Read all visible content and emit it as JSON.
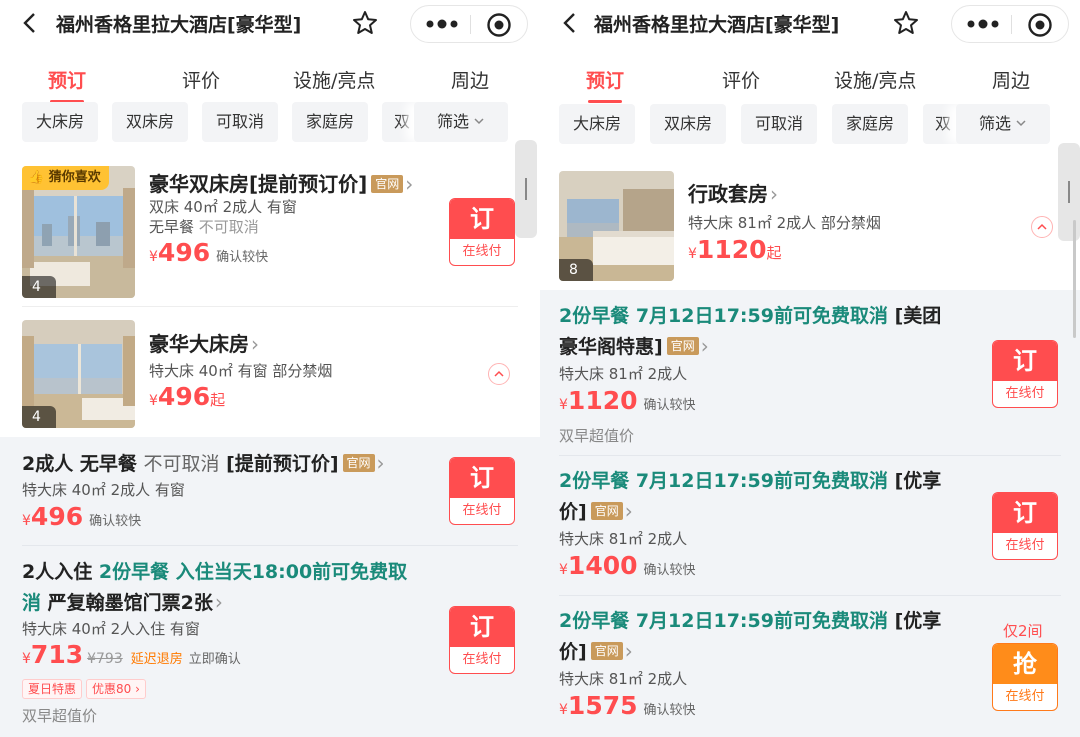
{
  "colors": {
    "accent": "#ff4d4f",
    "teal": "#1a8a7a",
    "official": "#c99a5b",
    "orange": "#ff8c1a",
    "sheet": "#f2f4f7"
  },
  "screen1": {
    "title": "福州香格里拉大酒店[豪华型]",
    "tabs": [
      "预订",
      "评价",
      "设施/亮点",
      "周边"
    ],
    "chips": [
      "大床房",
      "双床房",
      "可取消",
      "家庭房",
      "双"
    ],
    "filter": "筛选",
    "room1": {
      "badge": "猜你喜欢",
      "title": "豪华双床房[提前预订价]",
      "official": "官网",
      "line1": "双床 40㎡ 2成人 有窗",
      "line2a": "无早餐",
      "line2b": "不可取消",
      "currency": "¥",
      "price": "496",
      "confirm": "确认较快",
      "photo_count": "4",
      "book": "订",
      "pay": "在线付"
    },
    "room2": {
      "title": "豪华大床房",
      "line1": "特大床 40㎡ 有窗 部分禁烟",
      "currency": "¥",
      "price": "496",
      "qi": "起",
      "photo_count": "4"
    },
    "offer1": {
      "t1": "2成人",
      "t2": "无早餐",
      "t3": "不可取消",
      "t4": "[提前预订价]",
      "official": "官网",
      "line1": "特大床 40㎡ 2成人 有窗",
      "currency": "¥",
      "price": "496",
      "confirm": "确认较快",
      "book": "订",
      "pay": "在线付"
    },
    "offer2": {
      "t1": "2人入住",
      "t2": "2份早餐 入住当天18:00前可免费取消",
      "t3": "严复翰墨馆门票2张",
      "line1": "特大床 40㎡ 2人入住 有窗",
      "currency": "¥",
      "price": "713",
      "orig": "¥793",
      "late": "延迟退房",
      "instant": "立即确认",
      "tag1": "夏日特惠",
      "tag2": "优惠80",
      "note": "双早超值价",
      "book": "订",
      "pay": "在线付"
    }
  },
  "screen2": {
    "title": "福州香格里拉大酒店[豪华型]",
    "tabs": [
      "预订",
      "评价",
      "设施/亮点",
      "周边"
    ],
    "chips": [
      "大床房",
      "双床房",
      "可取消",
      "家庭房",
      "双"
    ],
    "filter": "筛选",
    "room": {
      "title": "行政套房",
      "line1": "特大床 81㎡ 2成人 部分禁烟",
      "currency": "¥",
      "price": "1120",
      "qi": "起",
      "photo_count": "8"
    },
    "offer1": {
      "t1": "2份早餐 7月12日17:59前可免费取消",
      "t2": "[美团豪华阁特惠]",
      "official": "官网",
      "line1": "特大床 81㎡ 2成人",
      "currency": "¥",
      "price": "1120",
      "confirm": "确认较快",
      "note": "双早超值价",
      "book": "订",
      "pay": "在线付"
    },
    "offer2": {
      "t1": "2份早餐 7月12日17:59前可免费取消",
      "t2": "[优享价]",
      "official": "官网",
      "line1": "特大床 81㎡ 2成人",
      "currency": "¥",
      "price": "1400",
      "confirm": "确认较快",
      "book": "订",
      "pay": "在线付"
    },
    "offer3": {
      "t1": "2份早餐 7月12日17:59前可免费取消",
      "t2": "[优享价]",
      "official": "官网",
      "line1": "特大床 81㎡ 2成人",
      "currency": "¥",
      "price": "1575",
      "confirm": "确认较快",
      "only": "仅2间",
      "book": "抢",
      "pay": "在线付"
    }
  }
}
